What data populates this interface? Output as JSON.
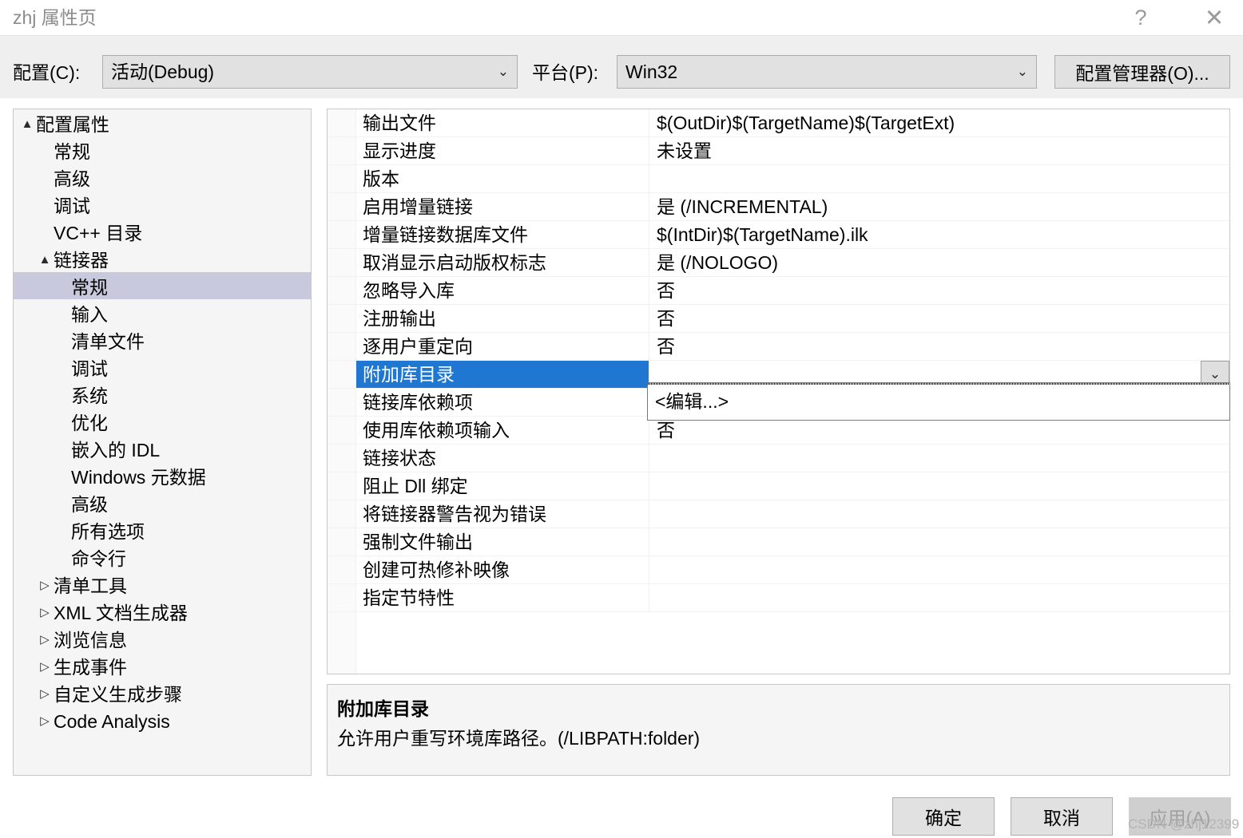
{
  "window": {
    "title": "zhj 属性页",
    "help_icon": "?",
    "close_icon": "✕"
  },
  "toolbar": {
    "config_label": "配置(C):",
    "config_value": "活动(Debug)",
    "platform_label": "平台(P):",
    "platform_value": "Win32",
    "config_manager_label": "配置管理器(O)...",
    "chevron_icon": "⌄"
  },
  "tree": {
    "items": [
      {
        "label": "配置属性",
        "level": 0,
        "twisty": "▲",
        "selected": false
      },
      {
        "label": "常规",
        "level": 1,
        "twisty": "",
        "selected": false
      },
      {
        "label": "高级",
        "level": 1,
        "twisty": "",
        "selected": false
      },
      {
        "label": "调试",
        "level": 1,
        "twisty": "",
        "selected": false
      },
      {
        "label": "VC++ 目录",
        "level": 1,
        "twisty": "",
        "selected": false
      },
      {
        "label": "链接器",
        "level": 1,
        "twisty": "▲",
        "selected": false
      },
      {
        "label": "常规",
        "level": 2,
        "twisty": "",
        "selected": true
      },
      {
        "label": "输入",
        "level": 2,
        "twisty": "",
        "selected": false
      },
      {
        "label": "清单文件",
        "level": 2,
        "twisty": "",
        "selected": false
      },
      {
        "label": "调试",
        "level": 2,
        "twisty": "",
        "selected": false
      },
      {
        "label": "系统",
        "level": 2,
        "twisty": "",
        "selected": false
      },
      {
        "label": "优化",
        "level": 2,
        "twisty": "",
        "selected": false
      },
      {
        "label": "嵌入的 IDL",
        "level": 2,
        "twisty": "",
        "selected": false
      },
      {
        "label": "Windows 元数据",
        "level": 2,
        "twisty": "",
        "selected": false
      },
      {
        "label": "高级",
        "level": 2,
        "twisty": "",
        "selected": false
      },
      {
        "label": "所有选项",
        "level": 2,
        "twisty": "",
        "selected": false
      },
      {
        "label": "命令行",
        "level": 2,
        "twisty": "",
        "selected": false
      },
      {
        "label": "清单工具",
        "level": 1,
        "twisty": "▷",
        "selected": false
      },
      {
        "label": "XML 文档生成器",
        "level": 1,
        "twisty": "▷",
        "selected": false
      },
      {
        "label": "浏览信息",
        "level": 1,
        "twisty": "▷",
        "selected": false
      },
      {
        "label": "生成事件",
        "level": 1,
        "twisty": "▷",
        "selected": false
      },
      {
        "label": "自定义生成步骤",
        "level": 1,
        "twisty": "▷",
        "selected": false
      },
      {
        "label": "Code Analysis",
        "level": 1,
        "twisty": "▷",
        "selected": false
      }
    ]
  },
  "grid": {
    "rows": [
      {
        "name": "输出文件",
        "value": "$(OutDir)$(TargetName)$(TargetExt)",
        "selected": false
      },
      {
        "name": "显示进度",
        "value": "未设置",
        "selected": false
      },
      {
        "name": "版本",
        "value": "",
        "selected": false
      },
      {
        "name": "启用增量链接",
        "value": "是 (/INCREMENTAL)",
        "selected": false
      },
      {
        "name": "增量链接数据库文件",
        "value": "$(IntDir)$(TargetName).ilk",
        "selected": false
      },
      {
        "name": "取消显示启动版权标志",
        "value": "是 (/NOLOGO)",
        "selected": false
      },
      {
        "name": "忽略导入库",
        "value": "否",
        "selected": false
      },
      {
        "name": "注册输出",
        "value": "否",
        "selected": false
      },
      {
        "name": "逐用户重定向",
        "value": "否",
        "selected": false
      },
      {
        "name": "附加库目录",
        "value": "",
        "selected": true
      },
      {
        "name": "链接库依赖项",
        "value": "",
        "selected": false
      },
      {
        "name": "使用库依赖项输入",
        "value": "否",
        "selected": false
      },
      {
        "name": "链接状态",
        "value": "",
        "selected": false
      },
      {
        "name": "阻止 Dll 绑定",
        "value": "",
        "selected": false
      },
      {
        "name": "将链接器警告视为错误",
        "value": "",
        "selected": false
      },
      {
        "name": "强制文件输出",
        "value": "",
        "selected": false
      },
      {
        "name": "创建可热修补映像",
        "value": "",
        "selected": false
      },
      {
        "name": "指定节特性",
        "value": "",
        "selected": false
      }
    ],
    "dropdown_button_icon": "⌄",
    "dropdown_item_label": "<编辑...>"
  },
  "description": {
    "title": "附加库目录",
    "body": "允许用户重写环境库路径。(/LIBPATH:folder)"
  },
  "footer": {
    "ok_label": "确定",
    "cancel_label": "取消",
    "apply_label": "应用(A)"
  },
  "watermark": {
    "text": "CSDN @zhj12399"
  },
  "colors": {
    "selection_blue": "#2077d2",
    "tree_selection": "#c8c9dc",
    "panel_bg": "#f5f5f5",
    "control_bg": "#e1e1e1",
    "strip_bg": "#efefef",
    "disabled_text": "#a0a0a0"
  }
}
